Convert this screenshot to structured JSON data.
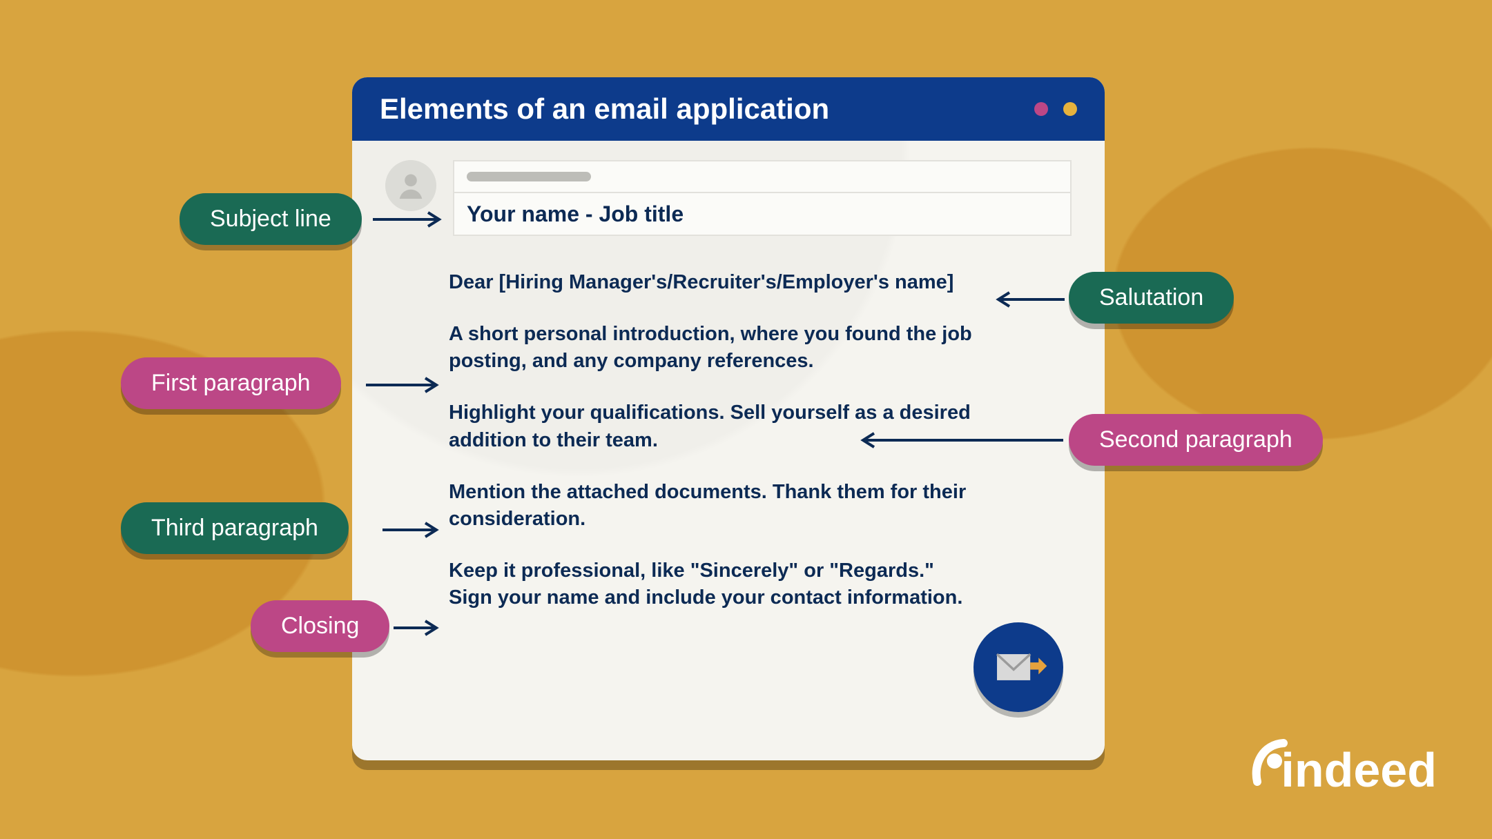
{
  "window": {
    "title": "Elements of an email application",
    "subject": "Your name - Job title",
    "salutation": "Dear [Hiring Manager's/Recruiter's/Employer's name]",
    "p1": "A short personal introduction, where you found the job posting, and any company references.",
    "p2": "Highlight your qualifications. Sell yourself as a desired addition to their team.",
    "p3": "Mention the attached documents. Thank them for their consideration.",
    "closing": "Keep it professional, like \"Sincerely\" or \"Regards.\" Sign your name and include your contact information."
  },
  "labels": {
    "subject": "Subject line",
    "salutation": "Salutation",
    "first": "First paragraph",
    "second": "Second paragraph",
    "third": "Third paragraph",
    "closing": "Closing"
  },
  "brand": "indeed",
  "colors": {
    "green": "#1a6a54",
    "magenta": "#bc4786",
    "blue": "#0d3b8b",
    "bg": "#d8a43f",
    "text": "#0c2a54"
  }
}
